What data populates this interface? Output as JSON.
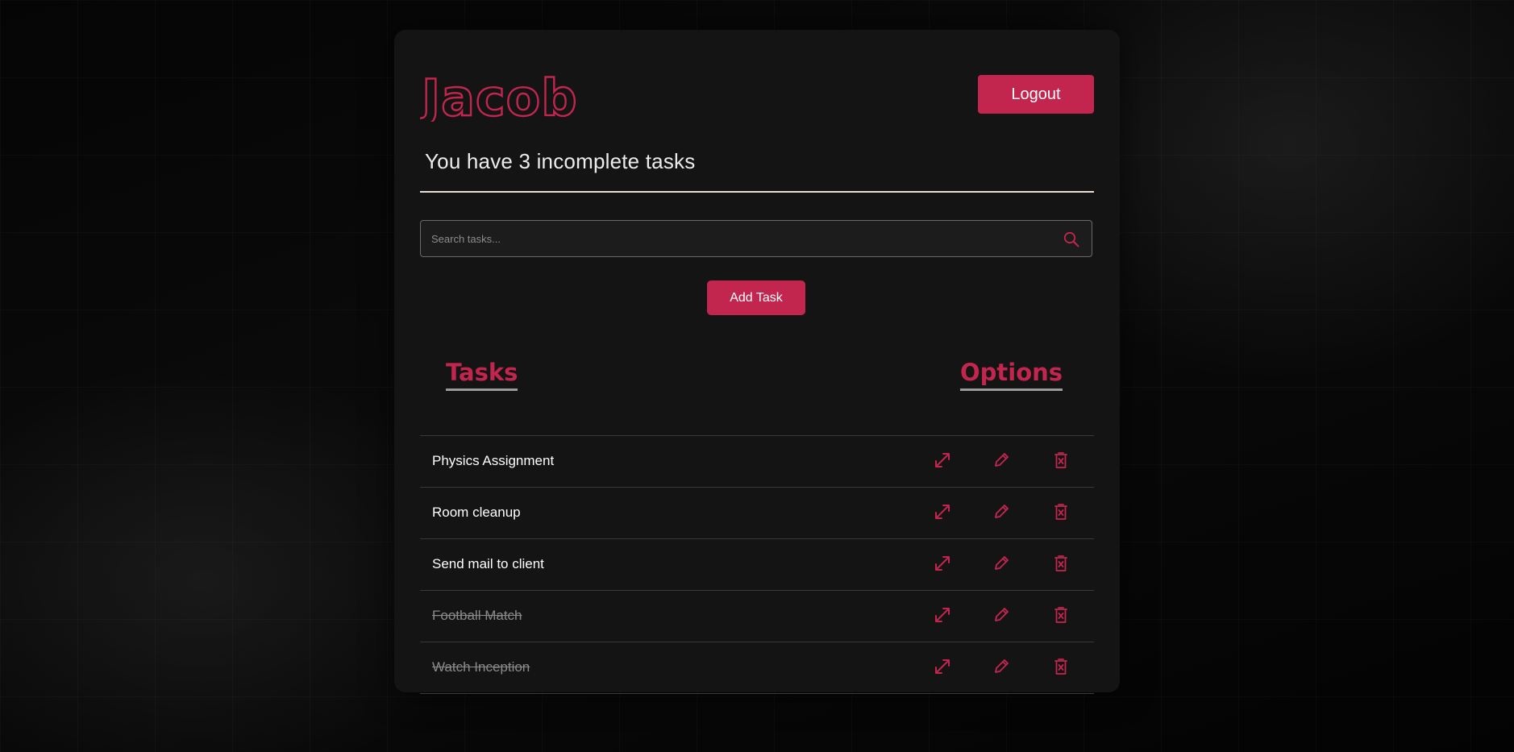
{
  "header": {
    "username": "Jacob",
    "logout_label": "Logout",
    "incomplete_message": "You have 3 incomplete tasks"
  },
  "search": {
    "placeholder": "Search tasks...",
    "value": ""
  },
  "actions": {
    "add_task_label": "Add Task"
  },
  "table": {
    "tasks_header": "Tasks",
    "options_header": "Options",
    "rows": [
      {
        "name": "Physics Assignment",
        "completed": false
      },
      {
        "name": "Room cleanup",
        "completed": false
      },
      {
        "name": "Send mail to client",
        "completed": false
      },
      {
        "name": "Football Match",
        "completed": true
      },
      {
        "name": "Watch Inception",
        "completed": true
      }
    ],
    "row_options": [
      "expand-icon",
      "edit-pencil-icon",
      "delete-icon"
    ]
  },
  "colors": {
    "accent": "#c2264f",
    "card": "#141414",
    "background": "#000000",
    "text": "#ffffff",
    "completed_text": "#8a8a8a"
  }
}
